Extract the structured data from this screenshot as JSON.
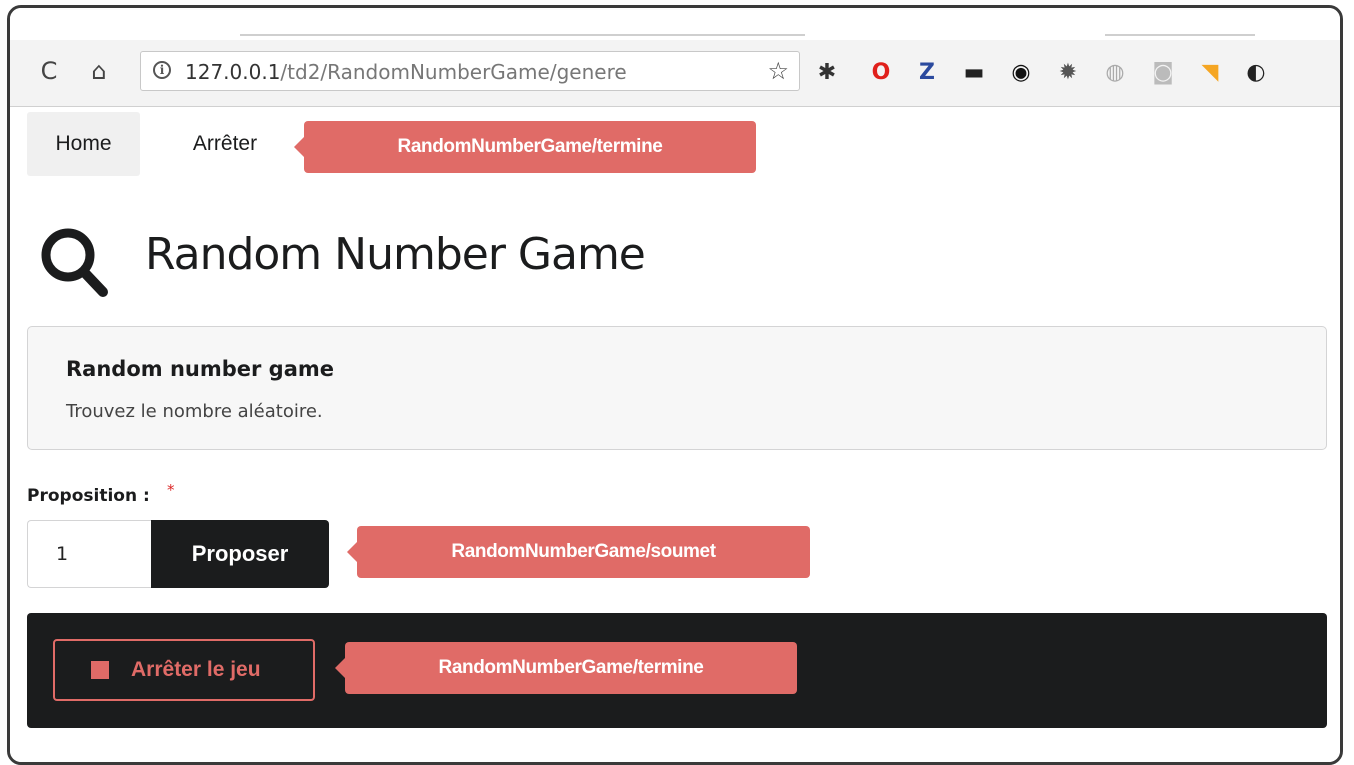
{
  "browser": {
    "reload_glyph": "C",
    "home_glyph": "⌂",
    "url_host": "127.0.0.1",
    "url_path": "/td2/RandomNumberGame/genere",
    "info_glyph": "i",
    "star_glyph": "☆",
    "extensions": [
      {
        "icon": "bug-icon",
        "glyph": "✱",
        "color": "#333333"
      },
      {
        "icon": "opera-icon",
        "glyph": "O",
        "color": "#e0201b"
      },
      {
        "icon": "zotero-icon",
        "glyph": "Z",
        "color": "#2b4a9e"
      },
      {
        "icon": "terminal-icon",
        "glyph": "▬",
        "color": "#222222"
      },
      {
        "icon": "eye-icon",
        "glyph": "◉",
        "color": "#111111"
      },
      {
        "icon": "gear-icon",
        "glyph": "✹",
        "color": "#555555"
      },
      {
        "icon": "fingerprint-icon",
        "glyph": "◍",
        "color": "#aaaaaa"
      },
      {
        "icon": "feed-grey-icon",
        "glyph": "◙",
        "color": "#bbbbbb"
      },
      {
        "icon": "rss-icon",
        "glyph": "◥",
        "color": "#f5a623"
      },
      {
        "icon": "partial-icon",
        "glyph": "◐",
        "color": "#222222"
      }
    ]
  },
  "menu": {
    "home": "Home",
    "stop": "Arrêter"
  },
  "callouts": {
    "menu_stop": "RandomNumberGame/termine",
    "submit": "RandomNumberGame/soumet",
    "stop_game": "RandomNumberGame/termine"
  },
  "header": {
    "title": "Random Number Game"
  },
  "message": {
    "header": "Random number game",
    "text": "Trouvez le nombre aléatoire."
  },
  "form": {
    "label": "Proposition :",
    "required_mark": "*",
    "value": "1",
    "submit_label": "Proposer"
  },
  "footer": {
    "stop_label": "Arrêter le jeu"
  },
  "colors": {
    "accent": "#e06b67",
    "dark": "#1b1c1d"
  }
}
